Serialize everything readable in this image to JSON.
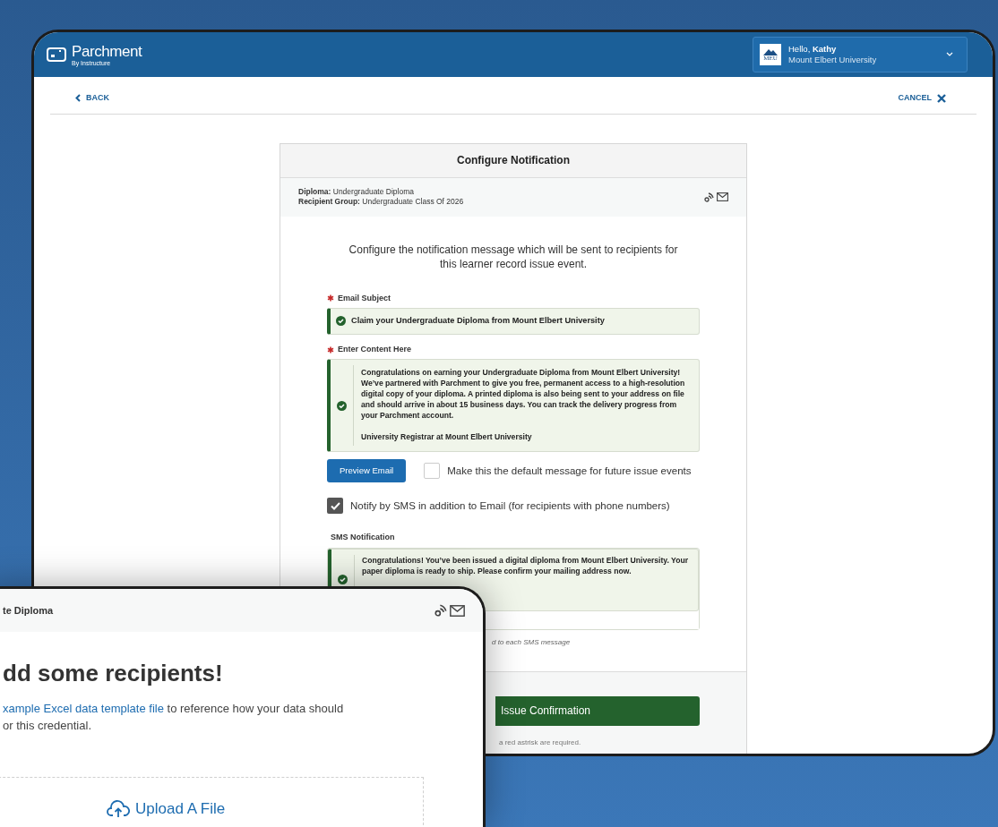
{
  "header": {
    "logo": "Parchment",
    "logo_sub": "By Instructure",
    "badge": "MEU",
    "greeting": "Hello, **Kathy**",
    "institution": "Mount Elbert University"
  },
  "nav": {
    "back": "BACK",
    "cancel": "CANCEL"
  },
  "card": {
    "title": "Configure Notification",
    "details": [
      "**Diploma:** Undergraduate Diploma",
      "**Recipient Group:** Undergraduate Class Of 2026"
    ],
    "intro": "Configure the notification message which will be sent to recipients for this learner record issue event.",
    "email_subject": {
      "label": "Email Subject",
      "required": true,
      "valid": true,
      "value": "Claim your Undergraduate Diploma from Mount Elbert University"
    },
    "content": {
      "label": "Enter Content Here",
      "required": true,
      "valid": true,
      "paragraphs": [
        "Congratulations on earning your Undergraduate Diploma from Mount Elbert University! We’ve partnered with Parchment to give you free, permanent access to a high-resolution digital copy of your diploma. A printed diploma is also being sent to your address on file and should arrive in about 15 business days. You can track the delivery progress from your Parchment account.",
        "University Registrar at Mount Elbert University"
      ]
    },
    "preview_button": "Preview Email",
    "default_checkbox": {
      "label": "Make this the default message for future issue events",
      "checked": false
    },
    "sms_checkbox": {
      "label": "Notify by SMS in addition to Email (for recipients with phone numbers)",
      "checked": true
    },
    "sms": {
      "label": "SMS Notification",
      "valid": true,
      "value": "Congratulations! You’ve been issued a digital diploma from Mount Elbert University. Your paper diploma is ready to ship. Please confirm your mailing address now."
    },
    "sms_hint": "d to each SMS message",
    "continue_button": "Issue Confirmation",
    "required_note": "a red astrisk are required."
  },
  "overlay": {
    "header": "te Diploma",
    "heading": "dd some recipients!",
    "link": "xample Excel data template file",
    "text_line_1": " to reference how your data should",
    "text_line_2": "or this credential.",
    "upload": "Upload A File"
  }
}
